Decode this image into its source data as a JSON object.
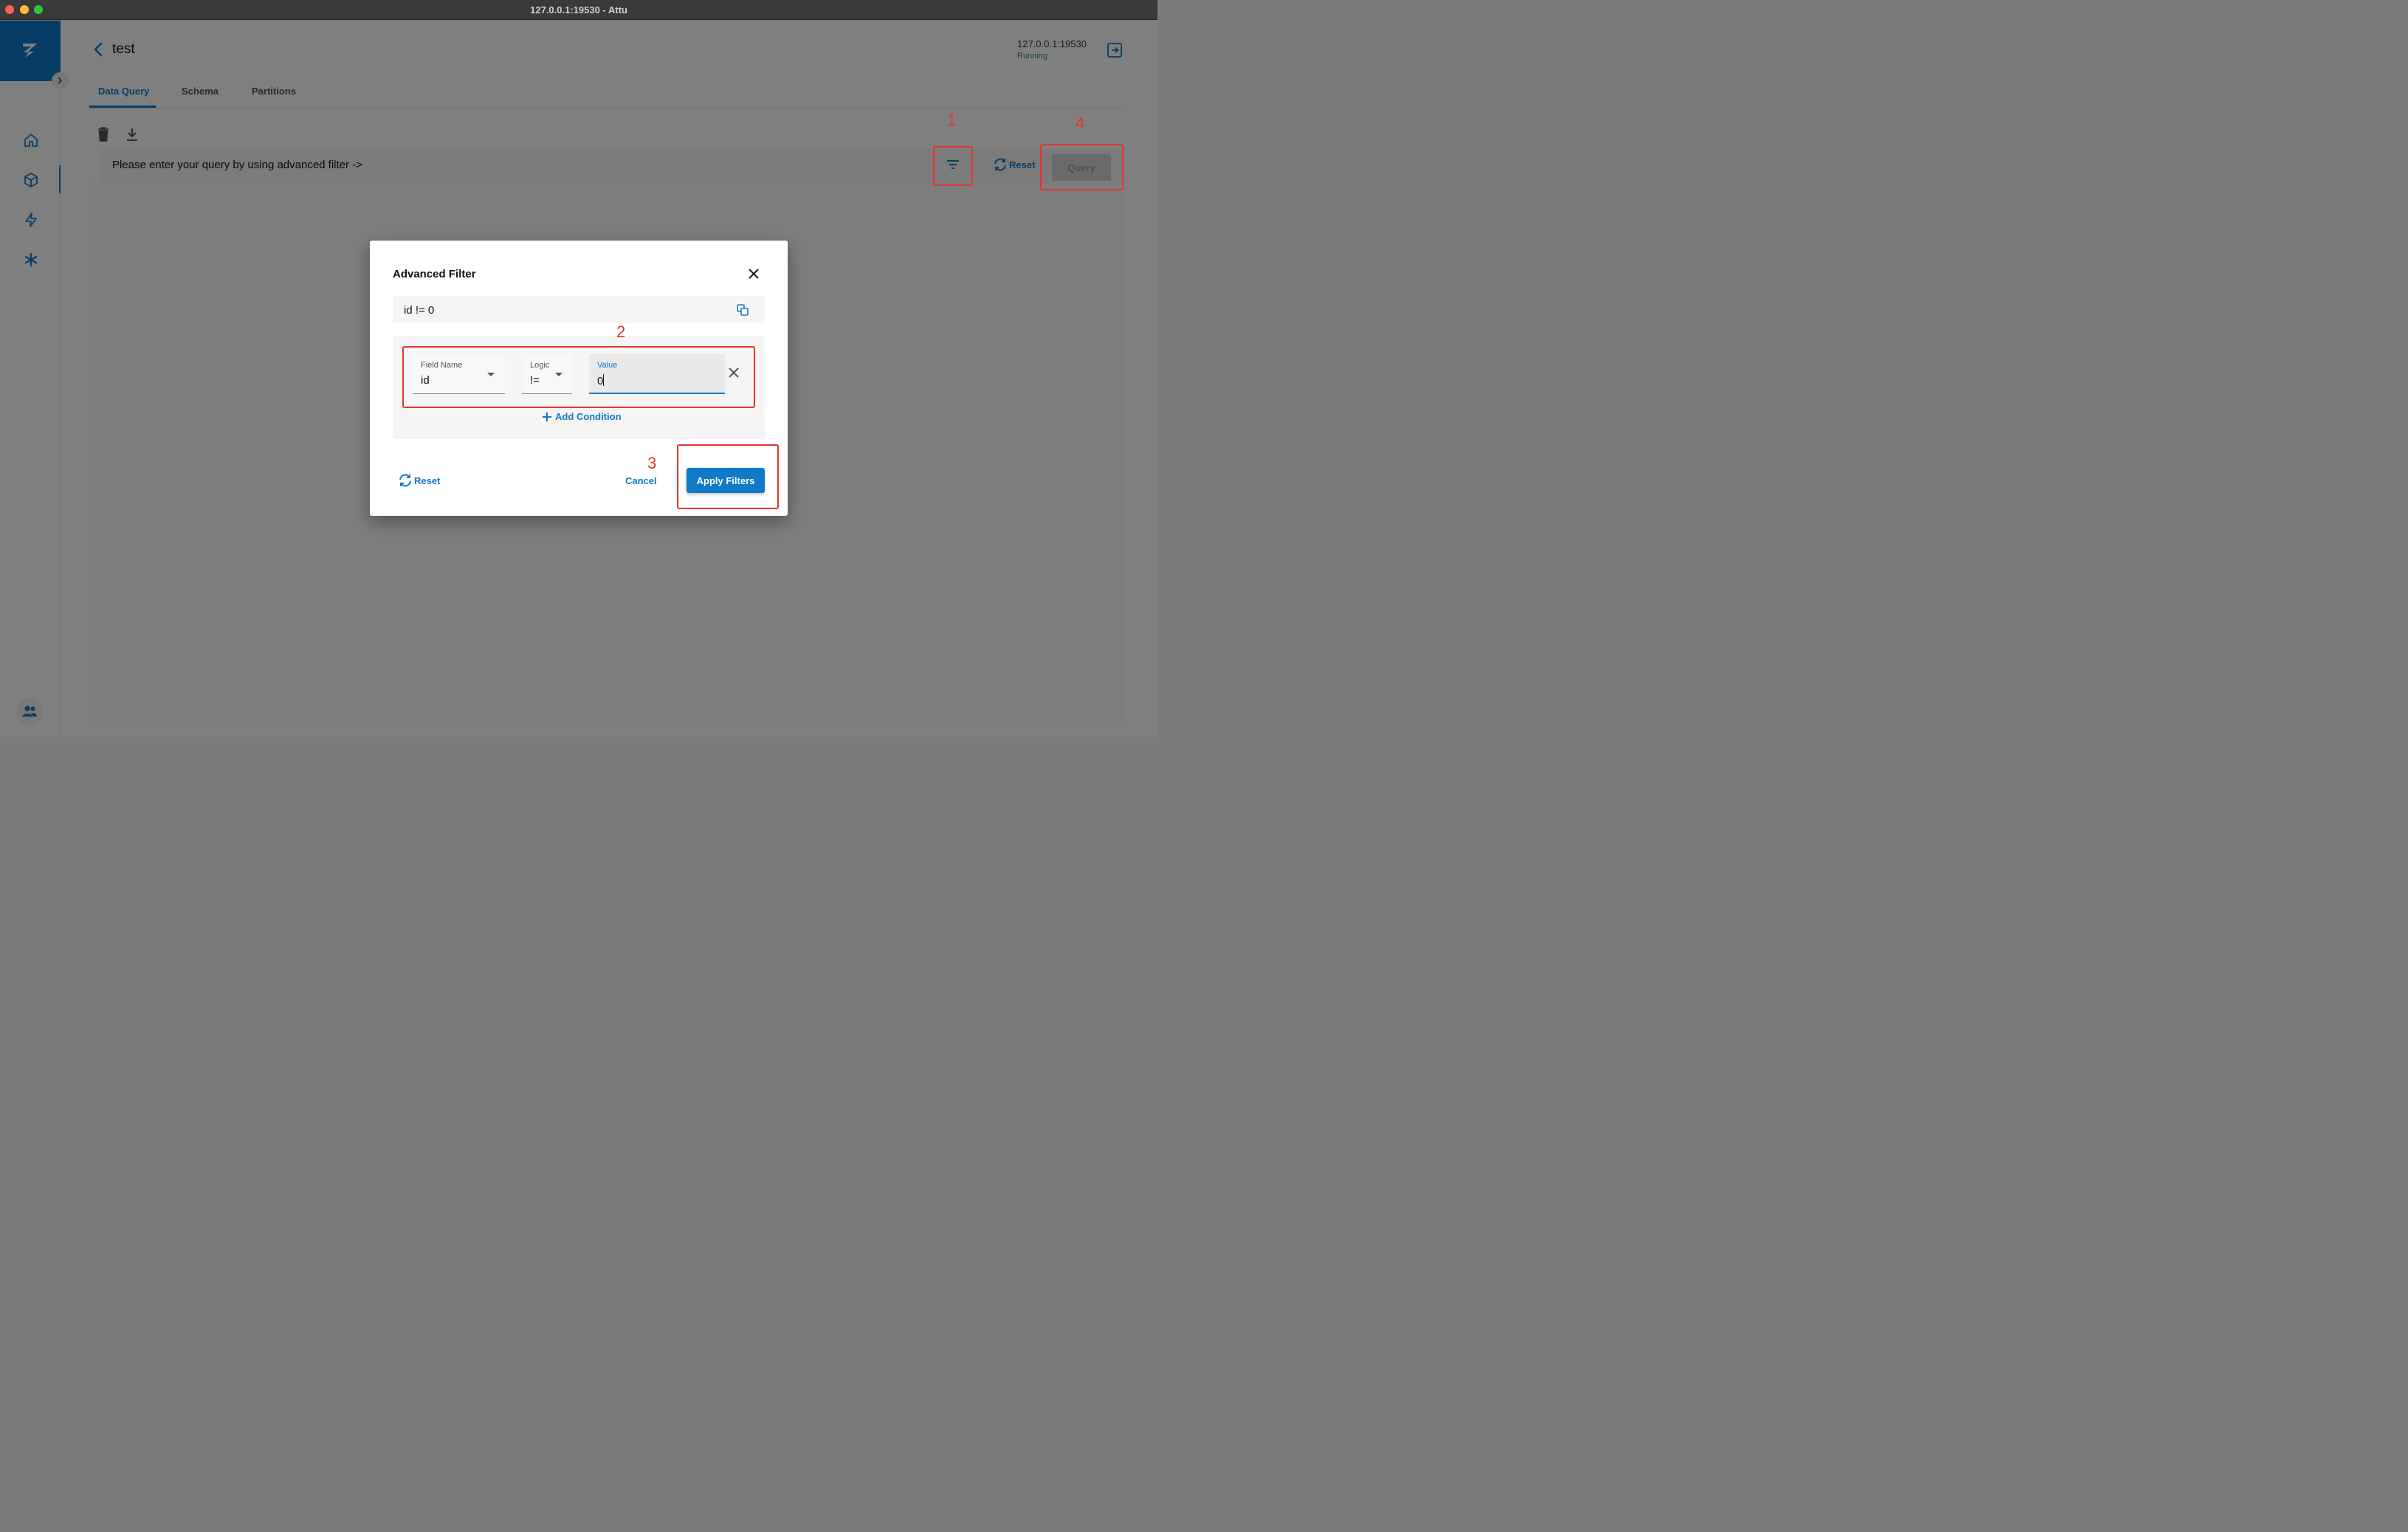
{
  "window": {
    "title": "127.0.0.1:19530 - Attu"
  },
  "header": {
    "title": "test",
    "connection_address": "127.0.0.1:19530",
    "connection_status": "Running"
  },
  "tabs": [
    {
      "label": "Data Query",
      "active": true
    },
    {
      "label": "Schema",
      "active": false
    },
    {
      "label": "Partitions",
      "active": false
    }
  ],
  "query_bar": {
    "placeholder_text": "Please enter your query by using advanced filter ->",
    "reset_label": "Reset",
    "query_label": "Query"
  },
  "dialog": {
    "title": "Advanced Filter",
    "expression": "id != 0",
    "condition": {
      "field_name_label": "Field Name",
      "field_name_value": "id",
      "logic_label": "Logic",
      "logic_value": "!=",
      "value_label": "Value",
      "value_value": "0"
    },
    "add_condition_label": "Add Condition",
    "reset_label": "Reset",
    "cancel_label": "Cancel",
    "apply_label": "Apply Filters"
  },
  "annotations": [
    "1",
    "2",
    "3",
    "4"
  ],
  "colors": {
    "accent": "#0f7ac8",
    "annotation": "#e5332a",
    "status_running": "#2e9d47"
  },
  "icons": {
    "sidebar": [
      "home-icon",
      "collection-cube-icon",
      "lightning-icon",
      "asterisk-icon",
      "users-icon"
    ],
    "toolbar": [
      "delete-icon",
      "download-icon",
      "filter-icon"
    ]
  }
}
